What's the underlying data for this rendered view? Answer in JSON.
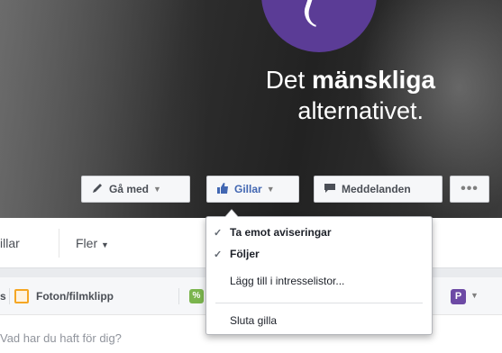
{
  "cover": {
    "slogan_prefix": "Det",
    "slogan_bold": "mänskliga",
    "slogan_line2": "alternativet."
  },
  "actions": {
    "join_label": "Gå med",
    "like_label": "Gillar",
    "message_label": "Meddelanden",
    "more_label": "•••"
  },
  "tabs": {
    "partial_label": "illar",
    "more_label": "Fler"
  },
  "composer": {
    "left_edge_label": "s",
    "photo_label": "Foton/filmklipp",
    "placeholder": "Vad har du haft för dig?"
  },
  "dropdown": {
    "items": [
      {
        "label": "Ta emot aviseringar",
        "checked": true
      },
      {
        "label": "Följer",
        "checked": true
      },
      {
        "label": "Lägg till i intresselistor...",
        "checked": false
      },
      {
        "label": "Sluta gilla",
        "checked": false
      }
    ]
  },
  "colors": {
    "brand_purple": "#5b3c96",
    "link_blue": "#4267b2",
    "photo_orange": "#f5a623",
    "green": "#7bb54d"
  }
}
